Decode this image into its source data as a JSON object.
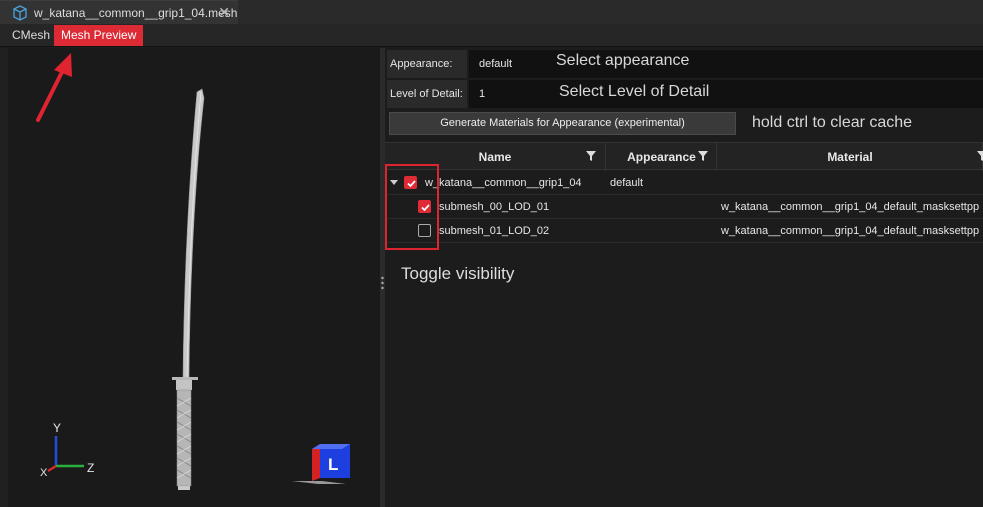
{
  "tab": {
    "title": "w_katana__common__grip1_04.mesh",
    "close": "✕"
  },
  "subtabs": {
    "cmesh": "CMesh",
    "mesh_preview": "Mesh Preview"
  },
  "props": {
    "appearance_label": "Appearance:",
    "appearance_value": "default",
    "lod_label": "Level of Detail:",
    "lod_value": "1"
  },
  "annotations": {
    "select_appearance": "Select appearance",
    "select_lod": "Select Level of Detail",
    "ctrl_hint": "hold ctrl to clear cache",
    "toggle_visibility": "Toggle visibility"
  },
  "generate_button": "Generate Materials for Appearance (experimental)",
  "grid": {
    "columns": {
      "name": "Name",
      "appearance": "Appearance",
      "material": "Material"
    },
    "rows": [
      {
        "name": "w_katana__common__grip1_04",
        "appearance": "default",
        "material": "",
        "checked": true
      },
      {
        "name": "submesh_00_LOD_01",
        "appearance": "",
        "material": "w_katana__common__grip1_04_default_masksettpp",
        "checked": true
      },
      {
        "name": "submesh_01_LOD_02",
        "appearance": "",
        "material": "w_katana__common__grip1_04_default_masksettpp",
        "checked": false
      }
    ]
  },
  "viewport": {
    "axis_labels": {
      "y": "Y",
      "x": "X",
      "z": "Z"
    },
    "view_cube_label": "L"
  },
  "colors": {
    "accent": "#dc2b35",
    "annotation_red": "#e0242f"
  }
}
